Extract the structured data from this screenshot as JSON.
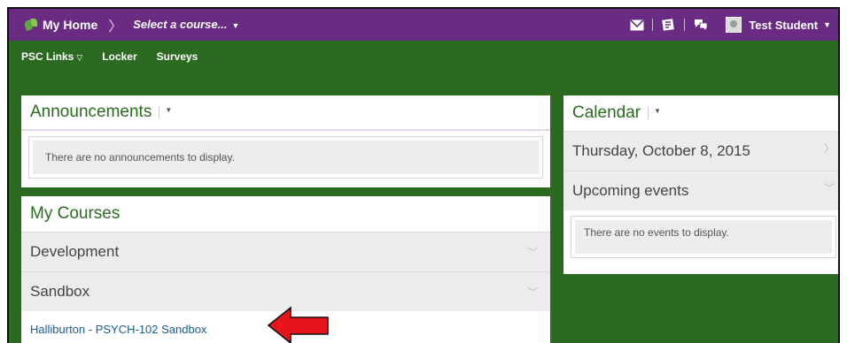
{
  "topbar": {
    "home_label": "My Home",
    "separator": "〉",
    "course_selector": "Select a course...",
    "user_name": "Test Student",
    "icons": [
      "logo-icon",
      "mail-icon",
      "update-icon",
      "chat-icon",
      "avatar-icon"
    ]
  },
  "navbar": {
    "items": [
      {
        "label": "PSC Links",
        "has_dropdown": true
      },
      {
        "label": "Locker"
      },
      {
        "label": "Surveys"
      }
    ]
  },
  "announcements": {
    "title": "Announcements",
    "empty_text": "There are no announcements to display."
  },
  "my_courses": {
    "title": "My Courses",
    "groups": [
      {
        "label": "Development"
      },
      {
        "label": "Sandbox"
      }
    ],
    "courses": [
      {
        "label": "Halliburton - PSYCH-102 Sandbox"
      }
    ]
  },
  "calendar": {
    "title": "Calendar",
    "date_label": "Thursday, October 8, 2015",
    "upcoming_label": "Upcoming events",
    "empty_text": "There are no events to display."
  },
  "colors": {
    "topbar": "#6a2c82",
    "background": "#2c6a22",
    "heading": "#2c6a22",
    "link": "#1a5c8a",
    "arrow": "#e8141b"
  }
}
